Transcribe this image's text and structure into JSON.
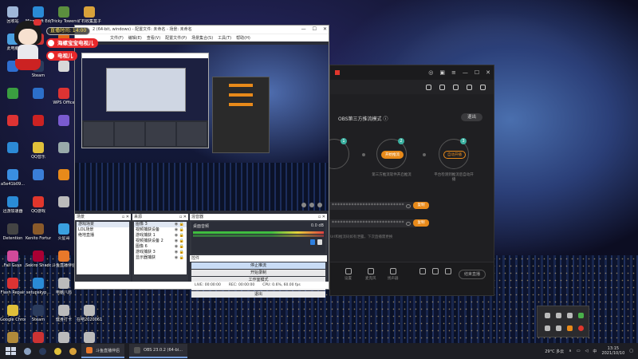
{
  "desktop": {
    "icons": [
      {
        "label": "回收站",
        "color": "#9fb7d8"
      },
      {
        "label": "Microsoft Edge",
        "color": "#2a8bd6"
      },
      {
        "label": "Tricky Towers",
        "color": "#5b8f3e"
      },
      {
        "label": "矿石收集盒子",
        "color": "#d9a23a"
      },
      {
        "label": "此电脑",
        "color": "#4aa0e0"
      },
      {
        "label": "",
        "color": "#c33"
      },
      {
        "label": "",
        "color": "#e06a1a"
      },
      {
        "label": "",
        "color": "#3a7ed8"
      },
      {
        "label": "",
        "color": "#2f6fd0"
      },
      {
        "label": "Steam",
        "color": "#2a3b5c"
      },
      {
        "label": "",
        "color": "#d8d8d8"
      },
      {
        "label": "",
        "color": "#d23"
      },
      {
        "label": "",
        "color": "#3a9e40"
      },
      {
        "label": "",
        "color": "#2c6fc9"
      },
      {
        "label": "WPS Office",
        "color": "#d33"
      },
      {
        "label": "",
        "color": "#e9a02a"
      },
      {
        "label": "",
        "color": "#d33"
      },
      {
        "label": "",
        "color": "#c22"
      },
      {
        "label": "",
        "color": "#7a5bd0"
      },
      {
        "label": "",
        "color": "#e0c03a"
      },
      {
        "label": "",
        "color": "#2c8ad6"
      },
      {
        "label": "QQ音乐",
        "color": "#e0c03a"
      },
      {
        "label": "",
        "color": "#9aa"
      },
      {
        "label": "",
        "color": "#c33"
      },
      {
        "label": "a5e41b09...",
        "color": "#3a8ee0"
      },
      {
        "label": "",
        "color": "#3a7ed8"
      },
      {
        "label": "",
        "color": "#e88a1a"
      },
      {
        "label": "",
        "color": "#bbb"
      },
      {
        "label": "迅游加速器",
        "color": "#2a8bd6"
      },
      {
        "label": "QQ游戏",
        "color": "#e0362c"
      },
      {
        "label": "",
        "color": "#bbb"
      },
      {
        "label": "",
        "color": "#bbb"
      },
      {
        "label": "Detention",
        "color": "#444"
      },
      {
        "label": "Kenito Fortune ...",
        "color": "#8a5a2a"
      },
      {
        "label": "火星哥",
        "color": "#3aa0e0"
      },
      {
        "label": "",
        "color": "#bbb"
      },
      {
        "label": "Fall Guys",
        "color": "#d04a9a"
      },
      {
        "label": "Sekiro Shadows...",
        "color": "#a03"
      },
      {
        "label": "斗鱼直播伴侣",
        "color": "#e8782a"
      },
      {
        "label": "",
        "color": "#bbb"
      },
      {
        "label": "Flash Repair",
        "color": "#d33"
      },
      {
        "label": "setupskyp...",
        "color": "#2a8bd6"
      },
      {
        "label": "电脑八局",
        "color": "#bbb"
      },
      {
        "label": "",
        "color": "#bbb"
      },
      {
        "label": "Google Chrome",
        "color": "#e0c03a"
      },
      {
        "label": "Steam",
        "color": "#2a3b5c"
      },
      {
        "label": "健身打卡",
        "color": "#bbb"
      },
      {
        "label": "在吧2020061...",
        "color": "#bbb"
      },
      {
        "label": "League of Legends",
        "color": "#b08a3a"
      },
      {
        "label": "",
        "color": "#c33"
      },
      {
        "label": "活跃用户回流",
        "color": "#bbb"
      },
      {
        "label": "要素游戏...",
        "color": "#bbb"
      }
    ]
  },
  "overlay": {
    "time_label": "直播时间: 14:00",
    "tag1": "海螺宝宝电视儿",
    "tag2": "电视儿"
  },
  "obs": {
    "title": "2 (64-bit, windows) - 配置文件: 未命名 - 场景: 未命名",
    "menu": [
      "文件(F)",
      "编辑(E)",
      "查看(V)",
      "配置文件(P)",
      "场景集合(S)",
      "工具(T)",
      "帮助(H)"
    ],
    "scenes_header": "场景",
    "scenes": [
      "游戏场景",
      "LOL场景",
      "绝地直播"
    ],
    "sources_header": "来源",
    "sources": [
      "图像 3",
      "视频捕获设备",
      "游戏捕获 1",
      "视频捕获设备 2",
      "图像 6",
      "游戏捕获 3",
      "显示器捕获"
    ],
    "mixer_header": "混音器",
    "mixer_track": "桌面音频",
    "mixer_value": "0.0 dB",
    "controls_header": "控件",
    "controls": [
      "停止推流",
      "开始录制",
      "工作室模式",
      "设置",
      "退出"
    ],
    "status": [
      "LIVE: 00:00:00",
      "REC: 00:00:00",
      "CPU: 0.6%, 60.00 fps"
    ]
  },
  "assistant": {
    "mode_label": "OBS第三方推流模式",
    "exit_label": "退出",
    "steps": [
      {
        "num": "1",
        "pill": "",
        "label": ""
      },
      {
        "num": "2",
        "pill": "开始推流",
        "label": "第三方推流软件开启推流"
      },
      {
        "num": "3",
        "pill": "自动开播",
        "label": "平台检测到推流后自动开播"
      }
    ],
    "server_mask": "**************************",
    "key_mask": "**************************",
    "copy_label": "复制",
    "hint": "Url和推流码如有泄露，下次直播需更换",
    "bottom_items": [
      "设置",
      "麦克风",
      "扬声器"
    ],
    "go_live": "结束直播"
  },
  "taskbar": {
    "apps": [
      {
        "label": "斗鱼直播伴侣",
        "color": "#e8782a"
      },
      {
        "label": "OBS 23.0.2 (64-bi...",
        "color": "#555"
      }
    ],
    "weather": "29°C 多云",
    "time": "13:15",
    "date": "2021/10/10"
  }
}
